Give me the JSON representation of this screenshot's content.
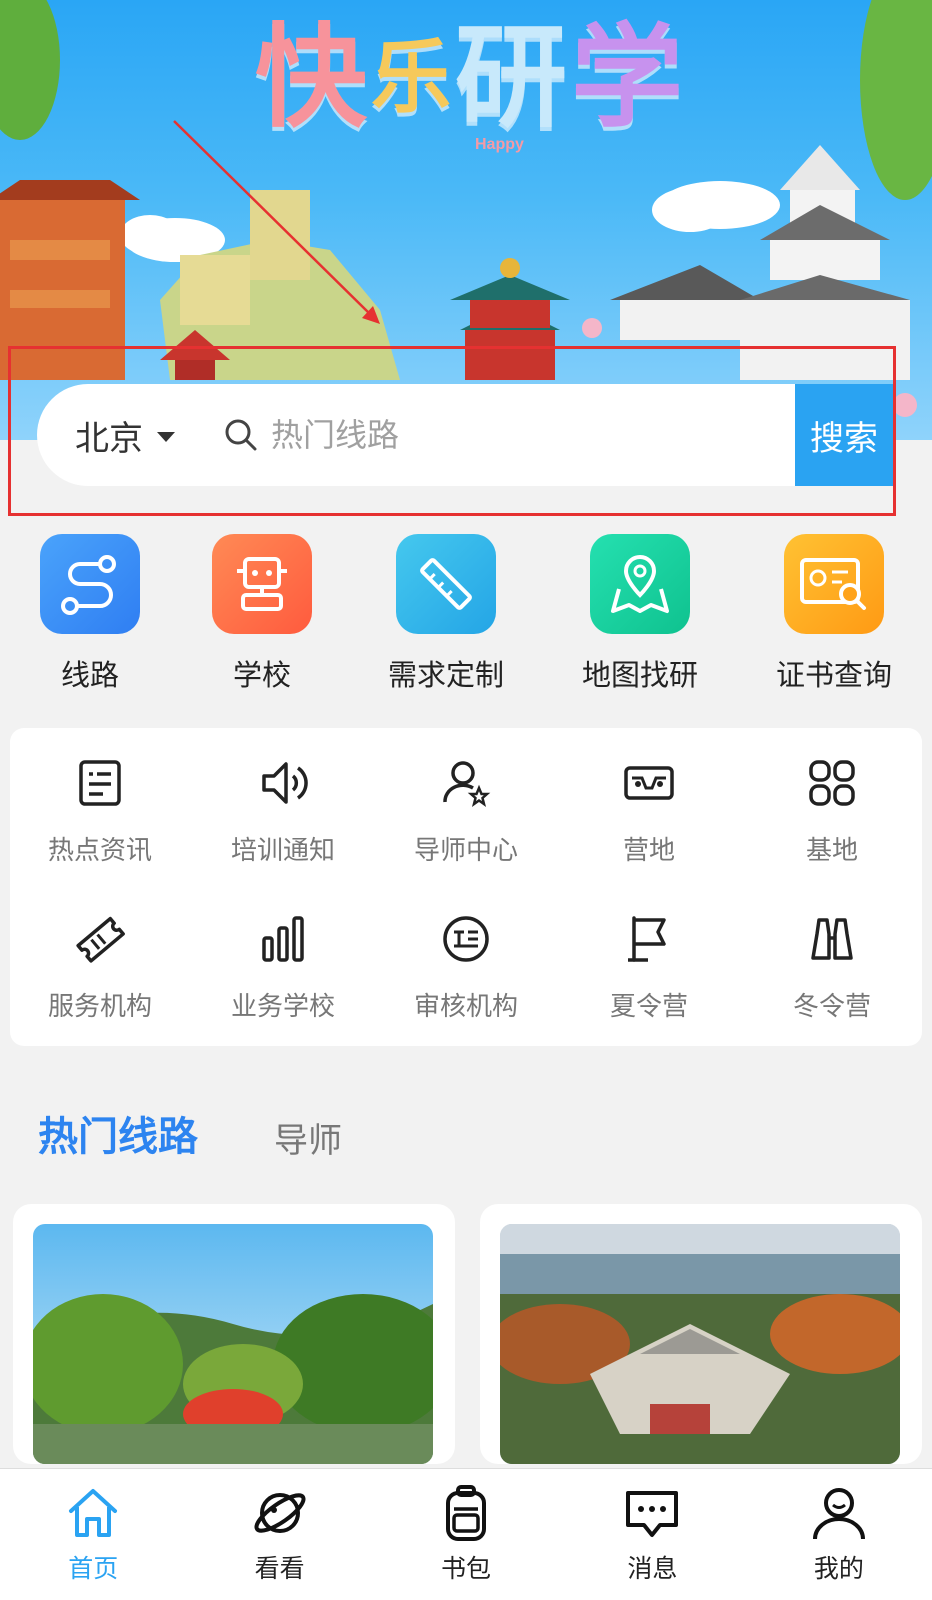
{
  "banner": {
    "title_chars": [
      "快",
      "乐",
      "研",
      "学"
    ],
    "subtitle": "Happy"
  },
  "search": {
    "city": "北京",
    "placeholder": "热门线路",
    "button_label": "搜索"
  },
  "quick_entries": [
    {
      "label": "线路",
      "icon": "route-icon",
      "color": "#3d8bf7"
    },
    {
      "label": "学校",
      "icon": "robot-icon",
      "color": "#ff6f47"
    },
    {
      "label": "需求定制",
      "icon": "pencil-ruler-icon",
      "color": "#33b8ea"
    },
    {
      "label": "地图找研",
      "icon": "map-pin-icon",
      "color": "#17d0a2"
    },
    {
      "label": "证书查询",
      "icon": "certificate-icon",
      "color": "#ffa31a"
    }
  ],
  "grid_entries": [
    {
      "label": "热点资讯",
      "icon": "news-icon"
    },
    {
      "label": "培训通知",
      "icon": "speaker-icon"
    },
    {
      "label": "导师中心",
      "icon": "mentor-icon"
    },
    {
      "label": "营地",
      "icon": "vr-glasses-icon"
    },
    {
      "label": "基地",
      "icon": "apps-icon"
    },
    {
      "label": "服务机构",
      "icon": "ticket-icon"
    },
    {
      "label": "业务学校",
      "icon": "bar-chart-icon"
    },
    {
      "label": "审核机构",
      "icon": "text-circle-icon"
    },
    {
      "label": "夏令营",
      "icon": "flag-icon"
    },
    {
      "label": "冬令营",
      "icon": "binoculars-icon"
    }
  ],
  "tabs": {
    "active": "热门线路",
    "other": "导师"
  },
  "tabbar": [
    {
      "label": "首页",
      "icon": "home-icon",
      "active": true
    },
    {
      "label": "看看",
      "icon": "planet-icon",
      "active": false
    },
    {
      "label": "书包",
      "icon": "backpack-icon",
      "active": false
    },
    {
      "label": "消息",
      "icon": "message-icon",
      "active": false
    },
    {
      "label": "我的",
      "icon": "user-icon",
      "active": false
    }
  ],
  "colors": {
    "accent": "#2aa3f2",
    "tab_active": "#2d84f0",
    "annotation": "#e63131"
  }
}
